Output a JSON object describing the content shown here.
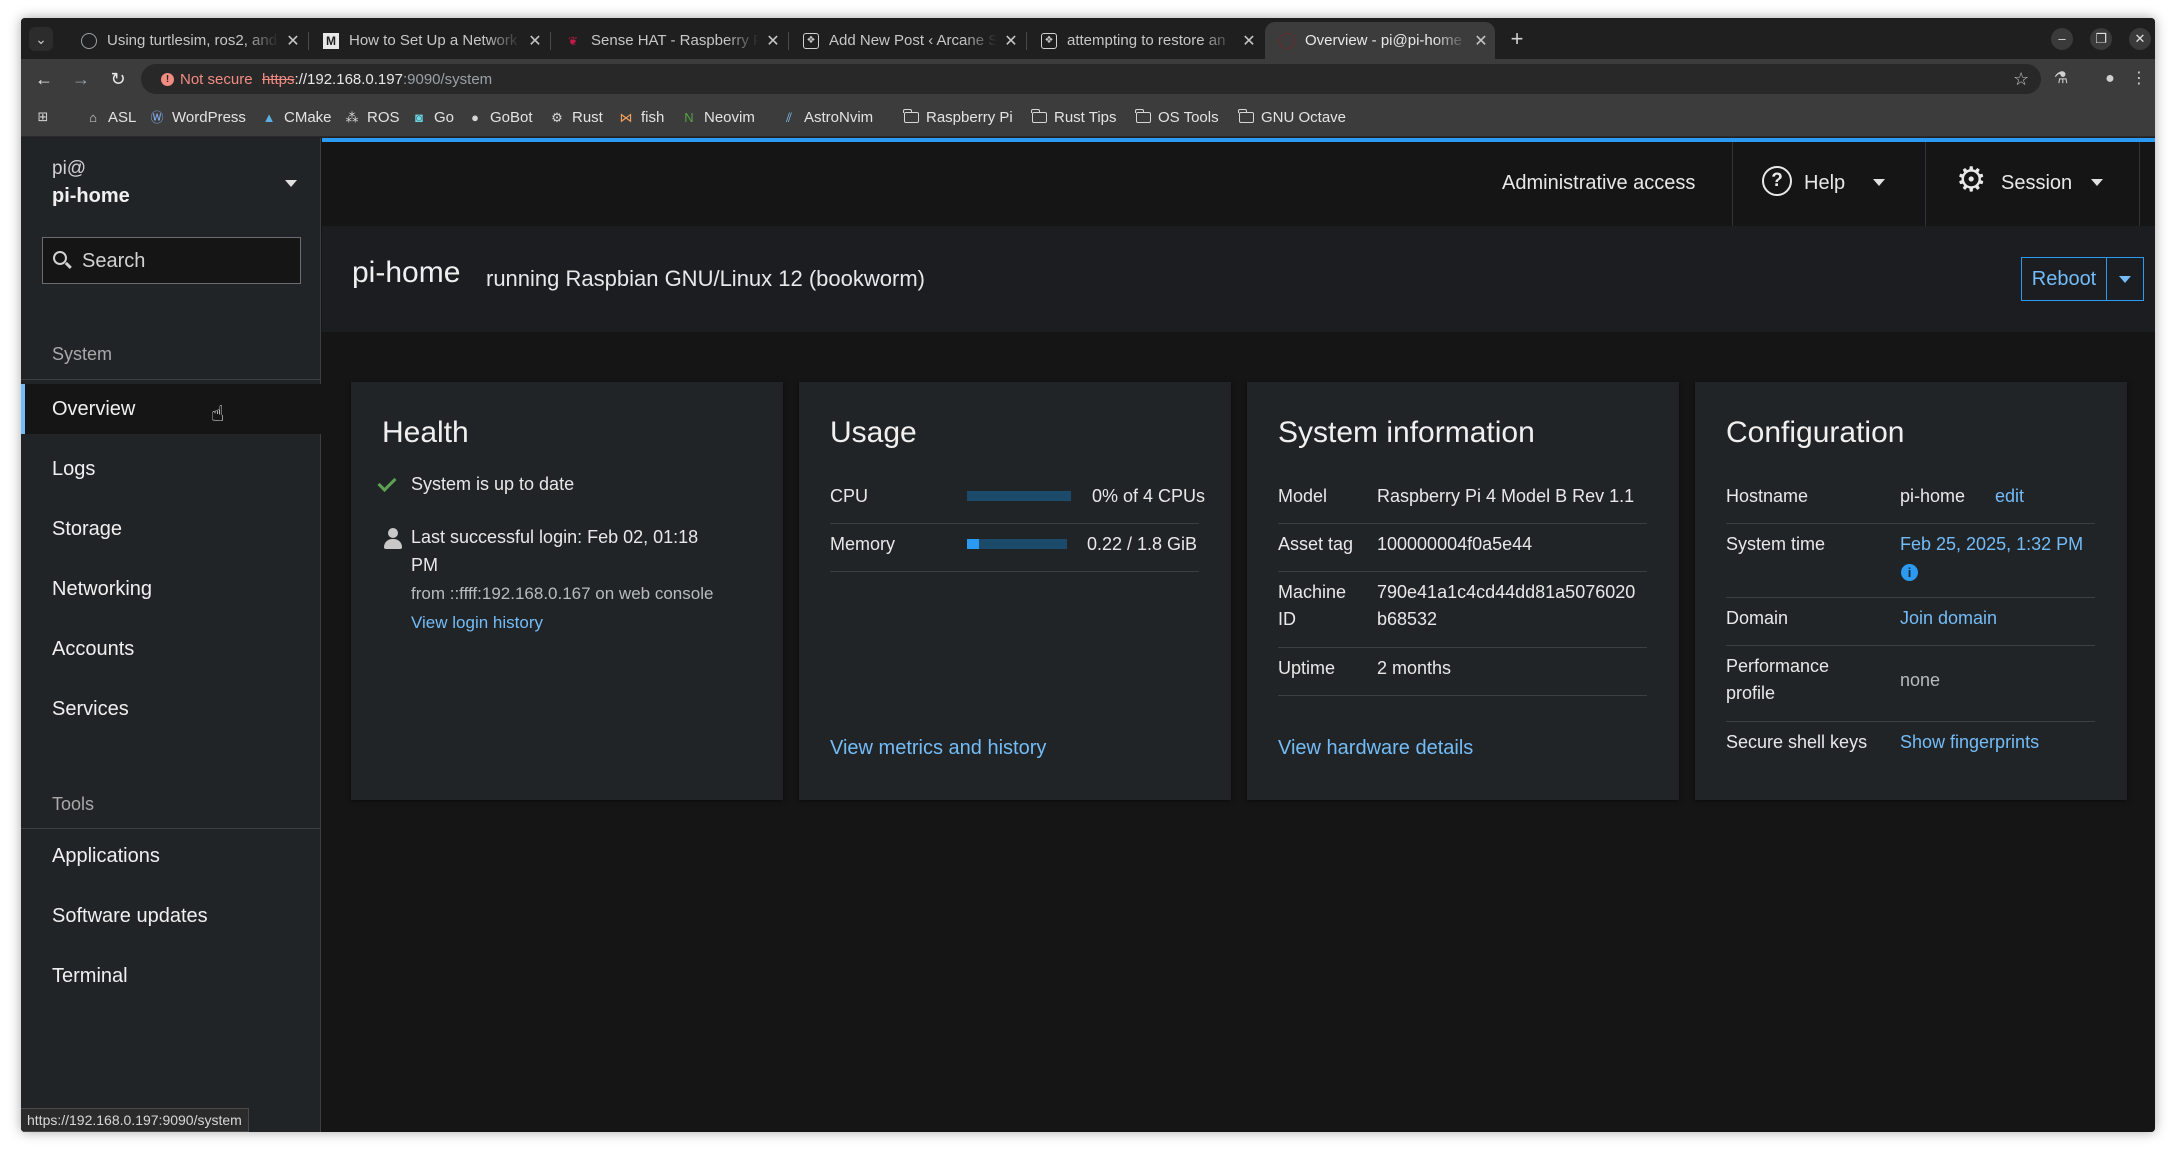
{
  "browser": {
    "tabs": [
      {
        "title": "Using turtlesim, ros2, and"
      },
      {
        "title": "How to Set Up a Network"
      },
      {
        "title": "Sense HAT - Raspberry Pi"
      },
      {
        "title": "Add New Post ‹ Arcane S"
      },
      {
        "title": "attempting to restore an"
      },
      {
        "title": "Overview - pi@pi-home"
      }
    ],
    "security": "Not secure",
    "url_scheme": "https",
    "url_host": "://192.168.0.197",
    "url_rest": ":9090/system",
    "bookmarks": [
      "ASL",
      "WordPress",
      "CMake",
      "ROS",
      "Go",
      "GoBot",
      "Rust",
      "fish",
      "Neovim",
      "AstroNvim",
      "Raspberry Pi",
      "Rust Tips",
      "OS Tools",
      "GNU Octave"
    ],
    "status_url": "https://192.168.0.197:9090/system"
  },
  "sidebar": {
    "user": "pi@",
    "host": "pi-home",
    "search_placeholder": "Search",
    "system_heading": "System",
    "system_items": [
      "Overview",
      "Logs",
      "Storage",
      "Networking",
      "Accounts",
      "Services"
    ],
    "tools_heading": "Tools",
    "tools_items": [
      "Applications",
      "Software updates",
      "Terminal"
    ]
  },
  "topbar": {
    "admin": "Administrative access",
    "help": "Help",
    "session": "Session"
  },
  "header": {
    "hostname": "pi-home",
    "os": "running Raspbian GNU/Linux 12 (bookworm)",
    "reboot": "Reboot"
  },
  "health": {
    "title": "Health",
    "updates": "System is up to date",
    "login_line1": "Last successful login: Feb 02, 01:18",
    "login_line2": "PM",
    "login_from": "from ::ffff:192.168.0.167 on web console",
    "login_history": "View login history"
  },
  "usage": {
    "title": "Usage",
    "cpu_label": "CPU",
    "cpu_value": "0% of 4 CPUs",
    "cpu_fraction": 0.0,
    "memory_label": "Memory",
    "memory_value": "0.22 / 1.8 GiB",
    "memory_fraction": 0.12,
    "link": "View metrics and history"
  },
  "sysinfo": {
    "title": "System information",
    "model_label": "Model",
    "model": "Raspberry Pi 4 Model B Rev 1.1",
    "asset_label": "Asset tag",
    "asset": "100000004f0a5e44",
    "machine_label_1": "Machine",
    "machine_label_2": "ID",
    "machine_1": "790e41a1c4cd44dd81a5076020",
    "machine_2": "b68532",
    "uptime_label": "Uptime",
    "uptime": "2 months",
    "link": "View hardware details"
  },
  "config": {
    "title": "Configuration",
    "hostname_label": "Hostname",
    "hostname": "pi-home",
    "edit": "edit",
    "time_label": "System time",
    "time": "Feb 25, 2025, 1:32 PM",
    "domain_label": "Domain",
    "domain": "Join domain",
    "perf_label_1": "Performance",
    "perf_label_2": "profile",
    "perf": "none",
    "ssh_label": "Secure shell keys",
    "ssh": "Show fingerprints"
  },
  "colors": {
    "accent": "#2b9af3",
    "link": "#73bcf7",
    "success": "#5ba352"
  }
}
